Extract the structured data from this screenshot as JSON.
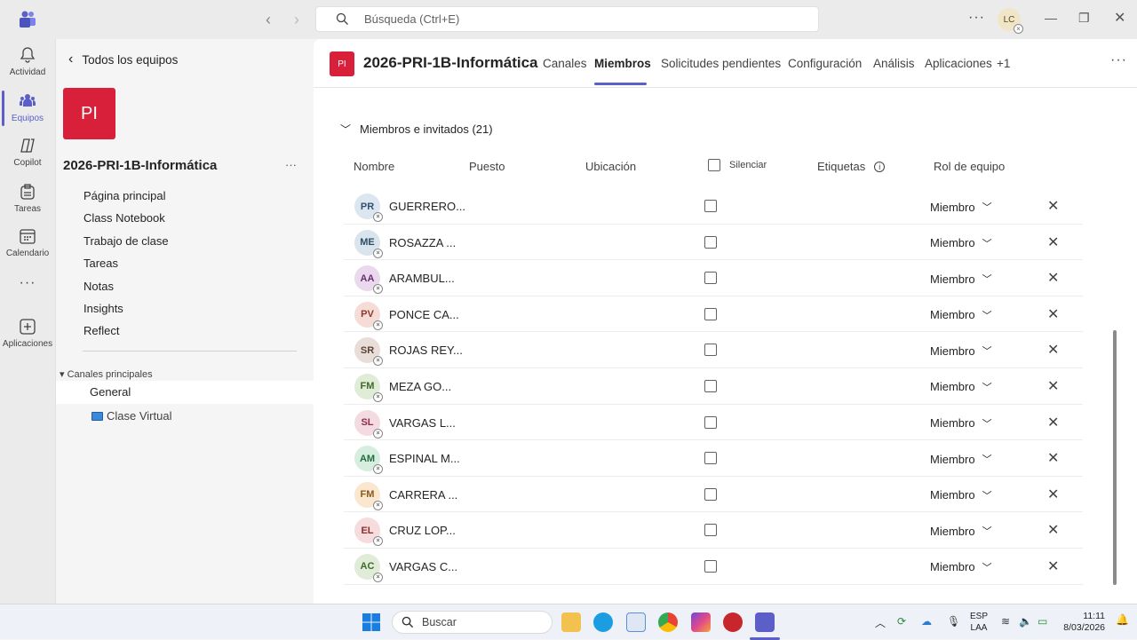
{
  "titlebar": {
    "search_placeholder": "Búsqueda (Ctrl+E)",
    "user_initials": "LC"
  },
  "rail": [
    {
      "label": "Actividad",
      "icon": "bell-icon"
    },
    {
      "label": "Equipos",
      "icon": "teams-icon",
      "active": true
    },
    {
      "label": "Copilot",
      "icon": "copilot-icon"
    },
    {
      "label": "Tareas",
      "icon": "tasks-icon"
    },
    {
      "label": "Calendario",
      "icon": "calendar-icon"
    },
    {
      "label": "Aplicaciones",
      "icon": "add-apps-icon"
    }
  ],
  "leftpanel": {
    "back_label": "Todos los equipos",
    "team_initials": "PI",
    "team_name": "2026-PRI-1B-Informática",
    "nav": [
      "Página principal",
      "Class Notebook",
      "Trabajo de clase",
      "Tareas",
      "Notas",
      "Insights",
      "Reflect"
    ],
    "channels_header": "Canales principales",
    "channels": [
      "General",
      "Clase Virtual"
    ]
  },
  "main": {
    "team_initials": "PI",
    "title": "2026-PRI-1B-Informática",
    "tabs": [
      "Canales",
      "Miembros",
      "Solicitudes pendientes",
      "Configuración",
      "Análisis",
      "Aplicaciones",
      "+1"
    ],
    "active_tab": "Miembros",
    "section_title": "Miembros e invitados (21)",
    "columns": {
      "name": "Nombre",
      "title": "Puesto",
      "location": "Ubicación",
      "mute": "Silenciar",
      "tags": "Etiquetas",
      "role": "Rol de equipo"
    },
    "members": [
      {
        "initials": "PR",
        "name": "GUERRERO...",
        "role": "Miembro",
        "color": "#dce6f0",
        "text": "#30506e"
      },
      {
        "initials": "ME",
        "name": "ROSAZZA ...",
        "role": "Miembro",
        "color": "#d9e4ec",
        "text": "#2c4d66"
      },
      {
        "initials": "AA",
        "name": "ARAMBUL...",
        "role": "Miembro",
        "color": "#ead9ec",
        "text": "#6b2f74"
      },
      {
        "initials": "PV",
        "name": "PONCE CA...",
        "role": "Miembro",
        "color": "#f6dcd6",
        "text": "#8a3a2a"
      },
      {
        "initials": "SR",
        "name": "ROJAS REY...",
        "role": "Miembro",
        "color": "#e8ddd8",
        "text": "#5e4036"
      },
      {
        "initials": "FM",
        "name": "MEZA GO...",
        "role": "Miembro",
        "color": "#e1ecd8",
        "text": "#3f6a27"
      },
      {
        "initials": "SL",
        "name": "VARGAS L...",
        "role": "Miembro",
        "color": "#f4dbe2",
        "text": "#8c2f4b"
      },
      {
        "initials": "AM",
        "name": "ESPINAL M...",
        "role": "Miembro",
        "color": "#d6eedf",
        "text": "#246b3f"
      },
      {
        "initials": "FM",
        "name": "CARRERA ...",
        "role": "Miembro",
        "color": "#fbe6d0",
        "text": "#8a5a1c"
      },
      {
        "initials": "EL",
        "name": "CRUZ LOP...",
        "role": "Miembro",
        "color": "#f6dcdc",
        "text": "#8c2e2e"
      },
      {
        "initials": "AC",
        "name": "VARGAS C...",
        "role": "Miembro",
        "color": "#e1ecd8",
        "text": "#3f6a27"
      }
    ]
  },
  "taskbar": {
    "search_label": "Buscar",
    "lang_line1": "ESP",
    "lang_line2": "LAA",
    "time": "11:11",
    "date": "8/03/2026"
  }
}
